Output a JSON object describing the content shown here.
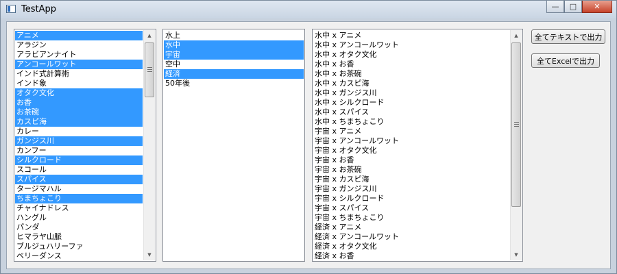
{
  "window": {
    "title": "TestApp"
  },
  "caption": {
    "minimize": "—",
    "maximize": "□",
    "close": "✕"
  },
  "list1": {
    "items": [
      {
        "label": "アニメ",
        "selected": true
      },
      {
        "label": "アラジン",
        "selected": false
      },
      {
        "label": "アラビアンナイト",
        "selected": false
      },
      {
        "label": "アンコールワット",
        "selected": true
      },
      {
        "label": "インド式計算術",
        "selected": false
      },
      {
        "label": "インド象",
        "selected": false
      },
      {
        "label": "オタク文化",
        "selected": true
      },
      {
        "label": "お香",
        "selected": true
      },
      {
        "label": "お茶碗",
        "selected": true
      },
      {
        "label": "カスピ海",
        "selected": true
      },
      {
        "label": "カレー",
        "selected": false
      },
      {
        "label": "ガンジス川",
        "selected": true
      },
      {
        "label": "カンフー",
        "selected": false
      },
      {
        "label": "シルクロード",
        "selected": true
      },
      {
        "label": "スコール",
        "selected": false
      },
      {
        "label": "スパイス",
        "selected": true
      },
      {
        "label": "タージマハル",
        "selected": false
      },
      {
        "label": "ちまちょこり",
        "selected": true
      },
      {
        "label": "チャイナドレス",
        "selected": false
      },
      {
        "label": "ハングル",
        "selected": false
      },
      {
        "label": "パンダ",
        "selected": false
      },
      {
        "label": "ヒマラヤ山脈",
        "selected": false
      },
      {
        "label": "ブルジュハリーファ",
        "selected": false
      },
      {
        "label": "ベリーダンス",
        "selected": false
      }
    ]
  },
  "list2": {
    "items": [
      {
        "label": "水上",
        "selected": false
      },
      {
        "label": "水中",
        "selected": true
      },
      {
        "label": "宇宙",
        "selected": true
      },
      {
        "label": "空中",
        "selected": false
      },
      {
        "label": "経済",
        "selected": true
      },
      {
        "label": "50年後",
        "selected": false
      }
    ]
  },
  "list3": {
    "items": [
      "水中 x アニメ",
      "水中 x アンコールワット",
      "水中 x オタク文化",
      "水中 x お香",
      "水中 x お茶碗",
      "水中 x カスピ海",
      "水中 x ガンジス川",
      "水中 x シルクロード",
      "水中 x スパイス",
      "水中 x ちまちょこり",
      "宇宙 x アニメ",
      "宇宙 x アンコールワット",
      "宇宙 x オタク文化",
      "宇宙 x お香",
      "宇宙 x お茶碗",
      "宇宙 x カスピ海",
      "宇宙 x ガンジス川",
      "宇宙 x シルクロード",
      "宇宙 x スパイス",
      "宇宙 x ちまちょこり",
      "経済 x アニメ",
      "経済 x アンコールワット",
      "経済 x オタク文化",
      "経済 x お香"
    ]
  },
  "buttons": {
    "export_text": "全てテキストで出力",
    "export_excel": "全てExcelで出力"
  },
  "icons": {
    "scroll_up": "▲",
    "scroll_down": "▼"
  }
}
